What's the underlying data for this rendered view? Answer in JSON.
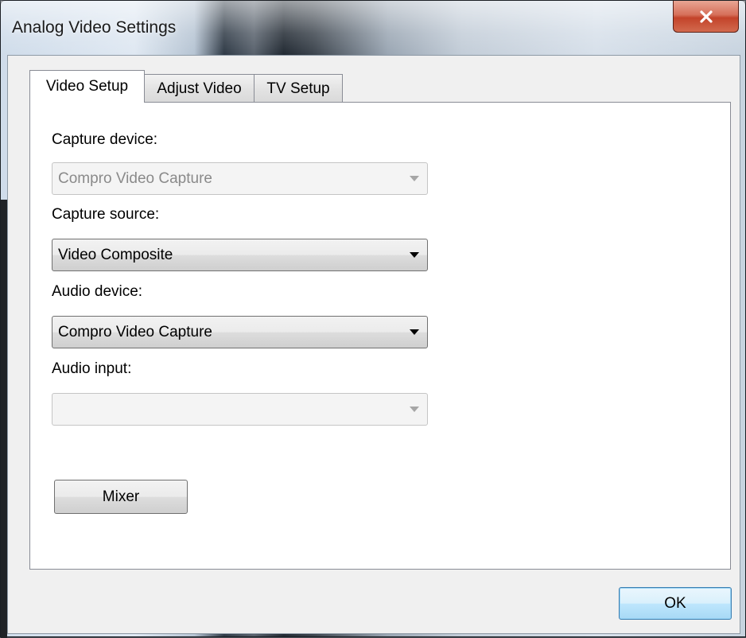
{
  "window": {
    "title": "Analog Video Settings",
    "close_label": "X"
  },
  "tabs": [
    {
      "label": "Video Setup",
      "active": true
    },
    {
      "label": "Adjust Video",
      "active": false
    },
    {
      "label": "TV Setup",
      "active": false
    }
  ],
  "video_setup": {
    "capture_device": {
      "label": "Capture device:",
      "value": "Compro Video Capture",
      "enabled": false
    },
    "capture_source": {
      "label": "Capture source:",
      "value": "Video Composite",
      "enabled": true
    },
    "audio_device": {
      "label": "Audio device:",
      "value": "Compro Video Capture",
      "enabled": true
    },
    "audio_input": {
      "label": "Audio input:",
      "value": "",
      "enabled": false
    },
    "mixer_label": "Mixer"
  },
  "footer": {
    "ok_label": "OK"
  },
  "colors": {
    "close_button": "#c3432a",
    "default_button_border": "#3c7fb1",
    "panel_background": "#ffffff",
    "dialog_background": "#f0f0f0"
  }
}
